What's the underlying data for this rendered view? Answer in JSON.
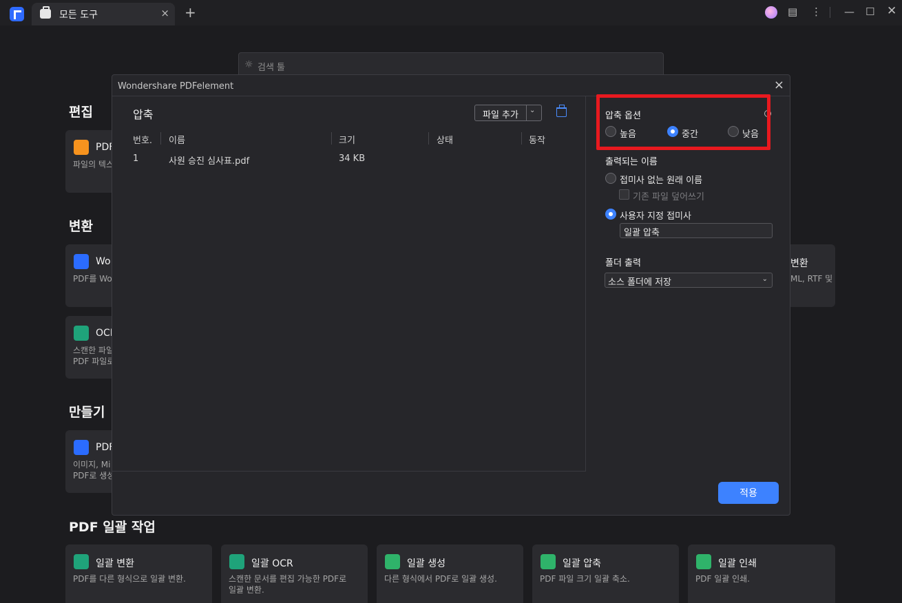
{
  "titlebar": {
    "tab_label": "모든 도구",
    "close": "×",
    "new_tab": "+"
  },
  "search": {
    "placeholder": "검색 툴"
  },
  "sections": {
    "edit": "편집",
    "convert": "변환",
    "create": "만들기",
    "batch": "PDF 일괄 작업"
  },
  "cards": {
    "edit_pdf": {
      "title": "PDF",
      "desc": "파일의 텍스"
    },
    "to_word": {
      "title": "Wo",
      "desc": "PDF를 Wo"
    },
    "ocr": {
      "title": "OCI",
      "desc": "스캔한 파일\nPDF 파일로"
    },
    "create_pdf": {
      "title": "PDF",
      "desc": "이미지, Mi\nPDF로 생성"
    },
    "to_other": {
      "title": "변환",
      "desc": "ML, RTF 및"
    },
    "batch_convert": {
      "title": "일괄 변환",
      "desc": "PDF를 다른 형식으로 일괄 변환."
    },
    "batch_ocr": {
      "title": "일괄 OCR",
      "desc": "스캔한 문서를 편집 가능한 PDF로\n일괄 변환."
    },
    "batch_create": {
      "title": "일괄 생성",
      "desc": "다른 형식에서 PDF로 일괄 생성."
    },
    "batch_compress": {
      "title": "일괄 압축",
      "desc": "PDF 파일 크기 일괄 축소."
    },
    "batch_print": {
      "title": "일괄 인쇄",
      "desc": "PDF 일괄 인쇄."
    }
  },
  "dialog": {
    "title": "Wondershare PDFelement",
    "close": "×",
    "pane_title": "압축",
    "add_file": "파일 추가",
    "add_file_caret": "⌄",
    "columns": [
      "번호.",
      "이름",
      "크기",
      "상태",
      "동작"
    ],
    "rows": [
      {
        "no": "1",
        "name": "사원 승진 심사표.pdf",
        "size": "34 KB",
        "status": "",
        "action": ""
      }
    ],
    "options": {
      "compression_label": "압축 옵션",
      "levels": [
        "높음",
        "중간",
        "낮음"
      ],
      "selected_level": "중간",
      "output_name_label": "출력되는 이름",
      "original_name": "접미사 없는 원래 이름",
      "overwrite": "기존 파일 덮어쓰기",
      "custom_suffix": "사용자 지정 접미사",
      "suffix_value": "일괄 압축",
      "folder_label": "폴더 출력",
      "folder_value": "소스 폴더에 저장",
      "folder_caret": "⌄"
    },
    "apply": "적용"
  },
  "colors": {
    "accent": "#3d82ff",
    "highlight": "#e8191f"
  }
}
